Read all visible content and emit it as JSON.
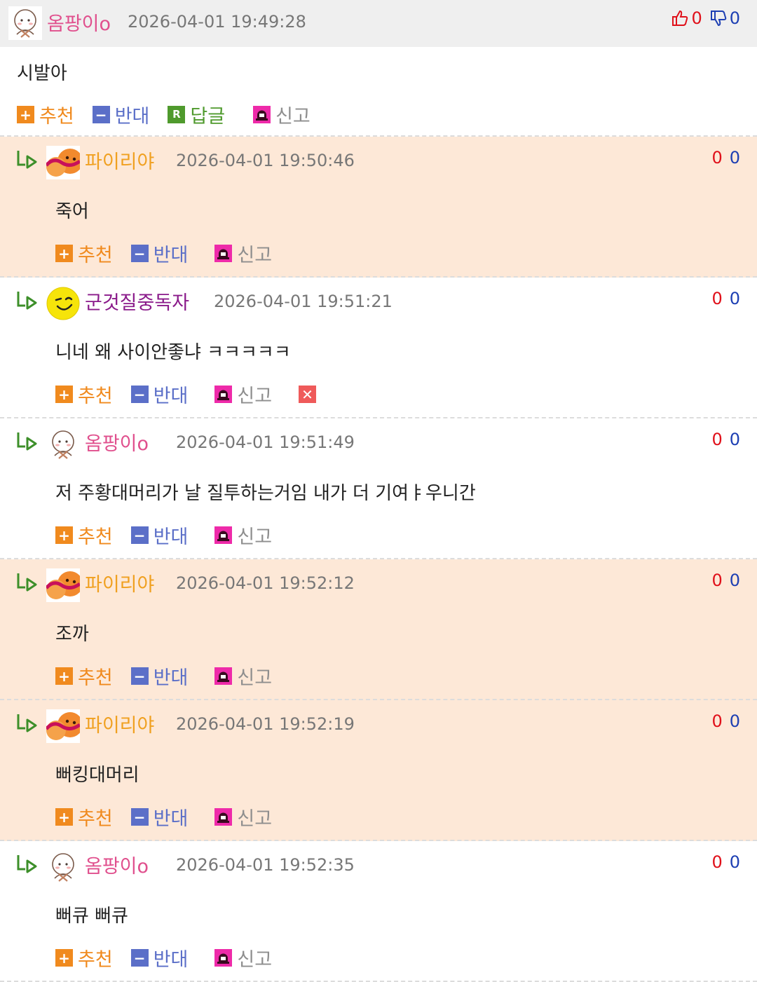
{
  "labels": {
    "up": "추천",
    "down": "반대",
    "reply": "답글",
    "report": "신고",
    "reply_icon": "R"
  },
  "top": {
    "nick": "옴팡이o",
    "nick_color": "#e04f8d",
    "date": "2026-04-01 19:49:28",
    "up": "0",
    "down": "0",
    "body": "시발아"
  },
  "replies": [
    {
      "nick": "파이리야",
      "nick_color": "#f0a020",
      "date": "2026-04-01 19:50:46",
      "body": "죽어",
      "up": "0",
      "down": "0",
      "bg": "peach",
      "avatar": "pairiya-avatar"
    },
    {
      "nick": "군것질중독자",
      "nick_color": "#8a1a8a",
      "date": "2026-04-01 19:51:21",
      "body": "니네 왜 사이안좋냐 ㅋㅋㅋㅋㅋ",
      "up": "0",
      "down": "0",
      "bg": "white",
      "avatar": "smiley-avatar",
      "deletable": true
    },
    {
      "nick": "옴팡이o",
      "nick_color": "#e04f8d",
      "date": "2026-04-01 19:51:49",
      "body": "저 주황대머리가 날 질투하는거임 내가 더 기여ㅑ우니간",
      "up": "0",
      "down": "0",
      "bg": "white",
      "avatar": "ompang-avatar"
    },
    {
      "nick": "파이리야",
      "nick_color": "#f0a020",
      "date": "2026-04-01 19:52:12",
      "body": "조까",
      "up": "0",
      "down": "0",
      "bg": "peach",
      "avatar": "pairiya-avatar"
    },
    {
      "nick": "파이리야",
      "nick_color": "#f0a020",
      "date": "2026-04-01 19:52:19",
      "body": "뻐킹대머리",
      "up": "0",
      "down": "0",
      "bg": "peach",
      "avatar": "pairiya-avatar"
    },
    {
      "nick": "옴팡이o",
      "nick_color": "#e04f8d",
      "date": "2026-04-01 19:52:35",
      "body": "뻐큐 뻐큐",
      "up": "0",
      "down": "0",
      "bg": "white",
      "avatar": "ompang-avatar"
    }
  ]
}
